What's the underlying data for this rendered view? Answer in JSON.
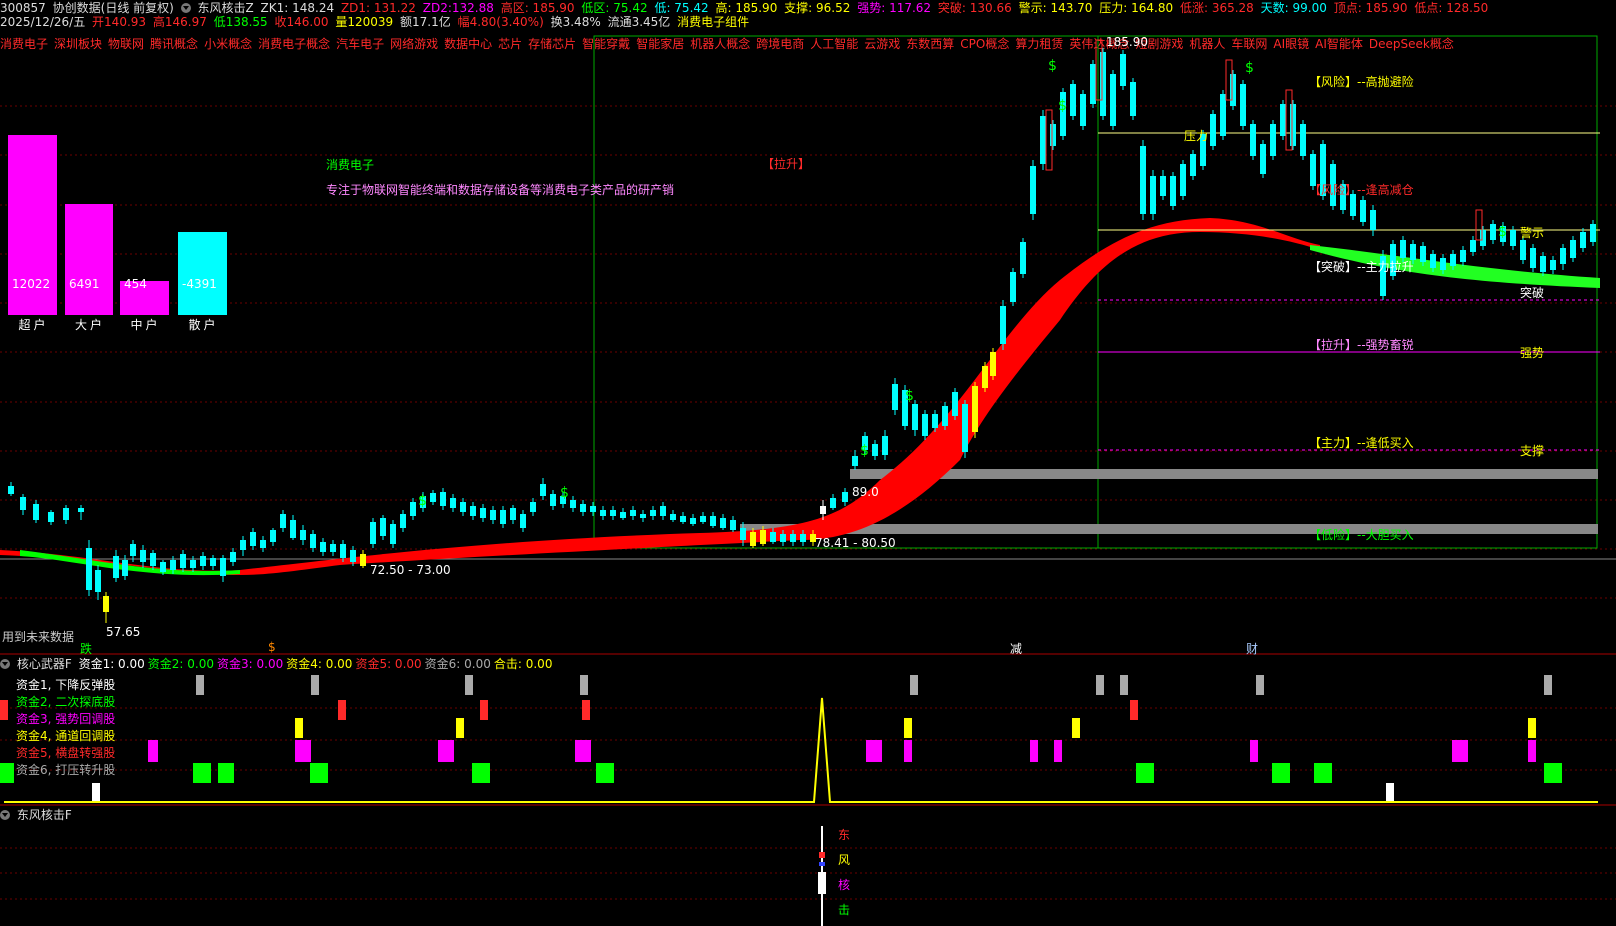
{
  "header": {
    "stock_code": "300857",
    "stock_name": "协创数据(日线 前复权)",
    "indicator_name": "东风核击Z",
    "zk1": "ZK1: 148.24",
    "zd1": "ZD1: 131.22",
    "zd2": "ZD2:132.88",
    "gaoqu": "高区: 185.90",
    "diqu": "低区: 75.42",
    "di": "低: 75.42",
    "gao": "高: 185.90",
    "zhicheng": "支撑: 96.52",
    "qiangshi": "强势: 117.62",
    "tupo": "突破: 130.66",
    "jingshi": "警示: 143.70",
    "yali": "压力: 164.80",
    "dishou": "低涨: 365.28",
    "tianshu": "天数: 99.00",
    "dingdian": "顶点: 185.90",
    "didian": "低点: 128.50"
  },
  "quote": {
    "date": "2025/12/26/五",
    "open": "开140.93",
    "high": "高146.97",
    "low": "低138.55",
    "close": "收146.00",
    "volume": "量120039",
    "amount": "额17.1亿",
    "change": "幅4.80(3.40%)",
    "turnover": "换3.48%",
    "float": "流通3.45亿",
    "concept": "消费电子组件"
  },
  "concepts": [
    "消费电子",
    "深圳板块",
    "物联网",
    "腾讯概念",
    "小米概念",
    "消费电子概念",
    "汽车电子",
    "网络游戏",
    "数据中心",
    "芯片",
    "存储芯片",
    "智能穿戴",
    "智能家居",
    "机器人概念",
    "跨境电商",
    "人工智能",
    "云游戏",
    "东数西算",
    "CPO概念",
    "算力租赁",
    "英伟达概念",
    "短剧游戏",
    "机器人",
    "车联网",
    "AI眼镜",
    "AI智能体",
    "DeepSeek概念"
  ],
  "money_bars": {
    "labels": [
      "超户",
      "大户",
      "中户",
      "散户"
    ],
    "values": [
      "12022",
      "6491",
      "454",
      "-4391"
    ],
    "colors": [
      "#ff00ff",
      "#ff00ff",
      "#ff00ff",
      "#00ffff"
    ]
  },
  "company": {
    "name": "消费电子",
    "desc": "专注于物联网智能终端和数据存储设备等消费电子类产品的研产销"
  },
  "annotations": {
    "lashen": "【拉升】",
    "fengxian": "【风险】--高抛避险",
    "fenghuo": "【风险】--逢高减仓",
    "tupo_zhu": "【突破】--主力拉升",
    "lasheng2": "【拉升】--强势畜锐",
    "zhuli": "【主力】--逢低买入",
    "dixian": "【低险】--大胆买入",
    "yali_line": "压力",
    "jingshi_line": "警示",
    "tupo_line": "突破",
    "qiangshi_line": "强势",
    "zhicheng_line": "支撑",
    "price_high": "185.90",
    "price_low": "57.65",
    "range1": "72.50 - 73.00",
    "range2": "78.41 - 80.50",
    "p89": "89.0",
    "future_note": "用到未来数据",
    "marker_die": "跌",
    "marker_dollar": "$",
    "marker_jian": "减",
    "marker_cai": "财"
  },
  "panel2": {
    "title": "核心武器F",
    "vals": [
      {
        "t": "资金1: 0.00",
        "c": "#ffffff"
      },
      {
        "t": "资金2: 0.00",
        "c": "#00ff00"
      },
      {
        "t": "资金3: 0.00",
        "c": "#ff00ff"
      },
      {
        "t": "资金4: 0.00",
        "c": "#ffff00"
      },
      {
        "t": "资金5: 0.00",
        "c": "#ff2a2a"
      },
      {
        "t": "资金6: 0.00",
        "c": "#aaaaaa"
      },
      {
        "t": "合击: 0.00",
        "c": "#ffff00"
      }
    ],
    "legend": [
      {
        "t": "资金1, 下降反弹股",
        "c": "#ffffff"
      },
      {
        "t": "资金2, 二次探底股",
        "c": "#00ff00"
      },
      {
        "t": "资金3, 强势回调股",
        "c": "#ff00ff"
      },
      {
        "t": "资金4, 通道回调股",
        "c": "#ffff00"
      },
      {
        "t": "资金5, 横盘转强股",
        "c": "#ff2a2a"
      },
      {
        "t": "资金6, 打压转升股",
        "c": "#aaaaaa"
      }
    ]
  },
  "panel3": {
    "title": "东风核击F",
    "chars": [
      "东",
      "风",
      "核",
      "击"
    ],
    "char_colors": [
      "#ff2a2a",
      "#ffff00",
      "#ff00ff",
      "#00ff00"
    ]
  }
}
